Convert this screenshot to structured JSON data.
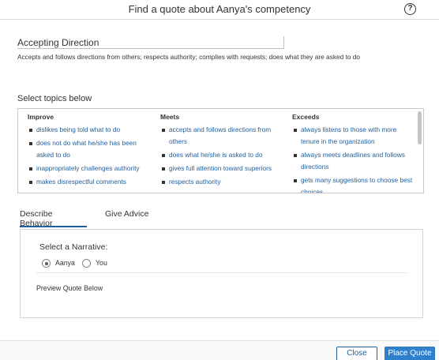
{
  "dialog": {
    "title": "Find a quote about Aanya's competency",
    "help_icon": "question-circle-icon"
  },
  "competency": {
    "name": "Accepting Direction",
    "description": "Accepts and follows directions from others; respects authority; complies with requests; does what they are asked to do"
  },
  "topics": {
    "heading": "Select topics below",
    "columns": [
      {
        "header": "Improve",
        "items": [
          "dislikes being told what to do",
          "does not do what he/she has been asked to do",
          "inappropriately challenges authority",
          "makes disrespectful comments"
        ]
      },
      {
        "header": "Meets",
        "items": [
          "accepts and follows directions from others",
          "does what he/she is asked to do",
          "gives full attention toward superiors",
          "respects authority"
        ]
      },
      {
        "header": "Exceeds",
        "items": [
          "always listens to those with more tenure in the organization",
          "always meets deadlines and follows directions",
          "gets many suggestions to choose best choices"
        ]
      }
    ]
  },
  "tabs": [
    {
      "label": "Describe Behavior",
      "active": true
    },
    {
      "label": "Give Advice",
      "active": false
    }
  ],
  "narrative": {
    "label": "Select a Narrative:",
    "options": [
      {
        "label": "Aanya",
        "selected": true
      },
      {
        "label": "You",
        "selected": false
      }
    ],
    "preview_label": "Preview Quote Below"
  },
  "buttons": {
    "close": "Close",
    "place_quote": "Place Quote"
  },
  "colors": {
    "link": "#1f5f9e",
    "primary_button": "#2f80cc"
  }
}
